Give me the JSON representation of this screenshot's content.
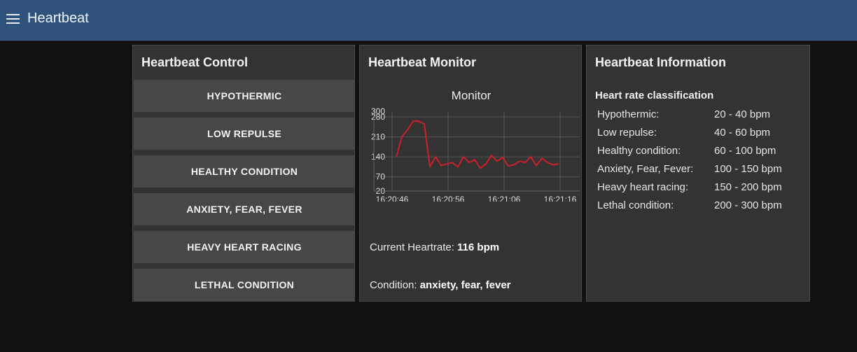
{
  "header": {
    "title": "Heartbeat",
    "menu_icon": "hamburger-menu-icon"
  },
  "control": {
    "title": "Heartbeat Control",
    "buttons": [
      {
        "label": "HYPOTHERMIC"
      },
      {
        "label": "LOW REPULSE"
      },
      {
        "label": "HEALTHY CONDITION"
      },
      {
        "label": "ANXIETY, FEAR, FEVER"
      },
      {
        "label": "HEAVY HEART RACING"
      },
      {
        "label": "LETHAL CONDITION"
      }
    ]
  },
  "monitor": {
    "title": "Heartbeat Monitor",
    "current_label": "Current Heartrate: ",
    "current_value": "116 bpm",
    "condition_label": "Condition: ",
    "condition_value": "anxiety, fear, fever"
  },
  "info": {
    "title": "Heartbeat Information",
    "heading": "Heart rate classification",
    "rows": [
      {
        "label": "Hypothermic:",
        "value": "20 - 40 bpm"
      },
      {
        "label": "Low repulse:",
        "value": "40 - 60 bpm"
      },
      {
        "label": "Healthy condition:",
        "value": "60 - 100 bpm"
      },
      {
        "label": "Anxiety, Fear, Fever:",
        "value": "100 - 150 bpm"
      },
      {
        "label": "Heavy heart racing:",
        "value": "150 - 200 bpm"
      },
      {
        "label": "Lethal condition:",
        "value": "200 - 300 bpm"
      }
    ]
  },
  "chart_data": {
    "type": "line",
    "title": "Monitor",
    "xlabel": "",
    "ylabel": "",
    "x_tick_labels": [
      "16:20:46",
      "16:20:56",
      "16:21:06",
      "16:21:16"
    ],
    "y_ticks": [
      20,
      70,
      140,
      210,
      280,
      300
    ],
    "ylim": [
      20,
      300
    ],
    "grid": true,
    "line_color": "#cc1f27",
    "series": [
      {
        "values": [
          140,
          210,
          235,
          265,
          265,
          255,
          105,
          140,
          110,
          115,
          120,
          105,
          140,
          120,
          130,
          100,
          115,
          145,
          125,
          138,
          108,
          112,
          125,
          120,
          140,
          110,
          135,
          120,
          112,
          116
        ]
      }
    ]
  }
}
